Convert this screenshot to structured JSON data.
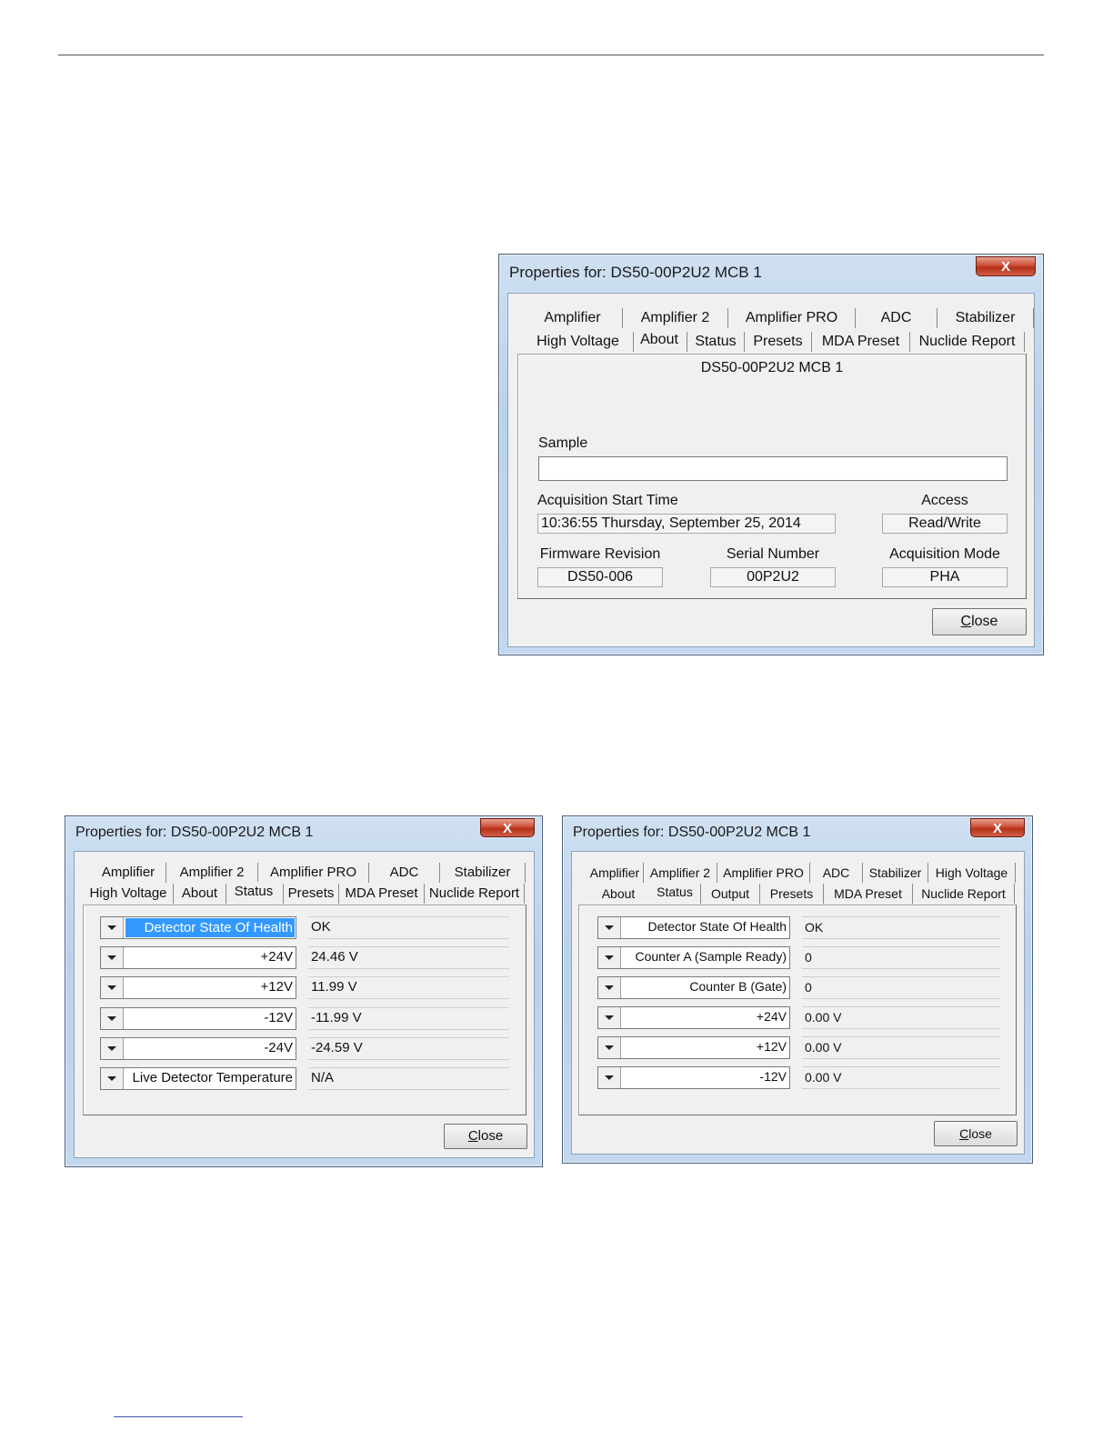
{
  "dialog_about": {
    "title": "Properties for: DS50-00P2U2 MCB 1",
    "close_x": "X",
    "tabs_row1": [
      "Amplifier",
      "Amplifier 2",
      "Amplifier PRO",
      "ADC",
      "Stabilizer"
    ],
    "tabs_row2": [
      "High Voltage",
      "About",
      "Status",
      "Presets",
      "MDA Preset",
      "Nuclide Report"
    ],
    "active_tab": "About",
    "device_name": "DS50-00P2U2 MCB 1",
    "sample_label": "Sample",
    "sample_value": "",
    "acq_start_label": "Acquisition Start Time",
    "acq_start_value": "10:36:55 Thursday, September 25, 2014",
    "access_label": "Access",
    "access_value": "Read/Write",
    "firmware_label": "Firmware Revision",
    "firmware_value": "DS50-006",
    "serial_label": "Serial Number",
    "serial_value": "00P2U2",
    "acq_mode_label": "Acquisition Mode",
    "acq_mode_value": "PHA",
    "close_button_first": "C",
    "close_button_rest": "lose"
  },
  "dialog_status_left": {
    "title": "Properties for: DS50-00P2U2 MCB 1",
    "close_x": "X",
    "tabs_row1": [
      "Amplifier",
      "Amplifier 2",
      "Amplifier PRO",
      "ADC",
      "Stabilizer"
    ],
    "tabs_row2": [
      "High Voltage",
      "About",
      "Status",
      "Presets",
      "MDA Preset",
      "Nuclide Report"
    ],
    "active_tab": "Status",
    "rows": [
      {
        "label": "Detector State Of Health",
        "value": "OK",
        "selected": true
      },
      {
        "label": "+24V",
        "value": "24.46 V"
      },
      {
        "label": "+12V",
        "value": "11.99 V"
      },
      {
        "label": "-12V",
        "value": "-11.99 V"
      },
      {
        "label": "-24V",
        "value": "-24.59 V"
      },
      {
        "label": "Live Detector Temperature",
        "value": "N/A"
      }
    ],
    "close_button_first": "C",
    "close_button_rest": "lose"
  },
  "dialog_status_right": {
    "title": "Properties for: DS50-00P2U2 MCB 1",
    "close_x": "X",
    "tabs_row1": [
      "Amplifier",
      "Amplifier 2",
      "Amplifier PRO",
      "ADC",
      "Stabilizer",
      "High Voltage"
    ],
    "tabs_row2": [
      "About",
      "Status",
      "Output",
      "Presets",
      "MDA Preset",
      "Nuclide Report"
    ],
    "active_tab": "Status",
    "rows": [
      {
        "label": "Detector State Of Health",
        "value": "OK"
      },
      {
        "label": "Counter A (Sample Ready)",
        "value": "0"
      },
      {
        "label": "Counter B (Gate)",
        "value": "0"
      },
      {
        "label": "+24V",
        "value": "0.00 V"
      },
      {
        "label": "+12V",
        "value": "0.00 V"
      },
      {
        "label": "-12V",
        "value": "0.00 V"
      }
    ],
    "close_button_first": "C",
    "close_button_rest": "lose"
  }
}
